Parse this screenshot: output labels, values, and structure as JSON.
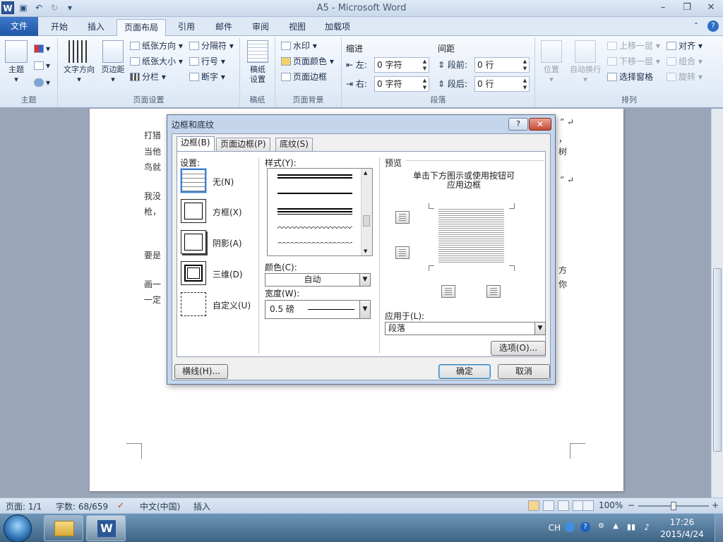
{
  "window": {
    "title": "A5 - Microsoft Word",
    "app_icon": "W",
    "minimize": "–",
    "maximize": "❐",
    "close": "✕"
  },
  "ribbon_tabs": [
    "文件",
    "开始",
    "插入",
    "页面布局",
    "引用",
    "邮件",
    "审阅",
    "视图",
    "加载项"
  ],
  "active_tab": "页面布局",
  "ribbon": {
    "theme_group": {
      "label": "主题",
      "theme_button": "主题"
    },
    "page_setup": {
      "label": "页面设置",
      "text_direction": "文字方向",
      "margins": "页边距",
      "orientation": "纸张方向",
      "size": "纸张大小",
      "columns": "分栏",
      "breaks": "分隔符",
      "line_numbers": "行号",
      "hyphenation": "断字"
    },
    "draft_group": {
      "label": "稿纸",
      "draft_settings_line1": "稿纸",
      "draft_settings_line2": "设置"
    },
    "page_background": {
      "label": "页面背景",
      "watermark": "水印",
      "page_color": "页面颜色",
      "page_borders": "页面边框"
    },
    "paragraph": {
      "label": "段落",
      "indent_title": "缩进",
      "spacing_title": "间距",
      "left_label": "左:",
      "left_value": "0 字符",
      "right_label": "右:",
      "right_value": "0 字符",
      "before_label": "段前:",
      "before_value": "0 行",
      "after_label": "段后:",
      "after_value": "0 行"
    },
    "arrange": {
      "label": "排列",
      "position": "位置",
      "wrap_text": "自动换行",
      "bring_forward": "上移一层",
      "send_backward": "下移一层",
      "selection_pane": "选择窗格",
      "align": "对齐",
      "group": "组合",
      "rotate": "旋转"
    }
  },
  "document": {
    "lines": [
      "打猎",
      "当他",
      "鸟就",
      "我没",
      "枪，",
      "要是",
      "画一",
      "一定"
    ],
    "right_fragments": [
      "，",
      "树",
      "方",
      "你"
    ],
    "quote_marks": [
      "” ↵",
      "” ↵"
    ]
  },
  "dialog": {
    "title": "边框和底纹",
    "help": "?",
    "close": "✕",
    "tabs": [
      "边框(B)",
      "页面边框(P)",
      "底纹(S)"
    ],
    "settings_label": "设置:",
    "settings": [
      "无(N)",
      "方框(X)",
      "阴影(A)",
      "三维(D)",
      "自定义(U)"
    ],
    "style_label": "样式(Y):",
    "color_label": "颜色(C):",
    "color_value": "自动",
    "width_label": "宽度(W):",
    "width_value": "0.5 磅",
    "preview_label": "预览",
    "preview_hint_line1": "单击下方图示或使用按钮可",
    "preview_hint_line2": "应用边框",
    "apply_label": "应用于(L):",
    "apply_value": "段落",
    "options_button": "选项(O)...",
    "horizontal_line_button": "横线(H)...",
    "ok_button": "确定",
    "cancel_button": "取消"
  },
  "statusbar": {
    "page": "页面: 1/1",
    "words": "字数: 68/659",
    "language": "中文(中国)",
    "insert_mode": "插入",
    "zoom": "100%",
    "zoom_out": "−",
    "zoom_in": "+"
  },
  "taskbar": {
    "lang": "CH",
    "time": "17:26",
    "date": "2015/4/24"
  },
  "colors": {
    "file_tab": "#2b5797",
    "ribbon_bg": "#dbe6f4",
    "dialog_frame": "#c5d6ec",
    "close_button": "#c64a33"
  }
}
